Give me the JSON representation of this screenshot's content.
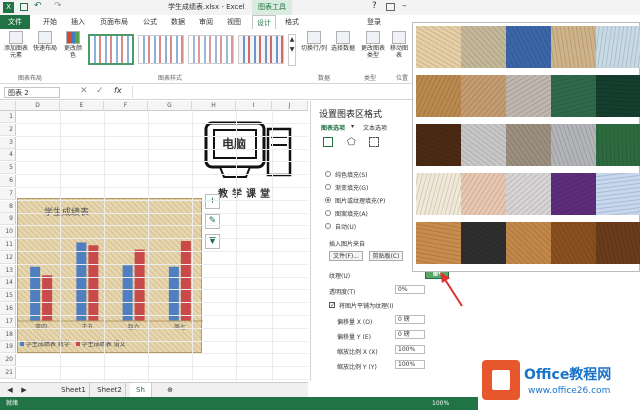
{
  "window": {
    "title": "学生成绩表.xlsx - Excel",
    "tool_context": "图表工具",
    "login": "登录"
  },
  "tabs": [
    "文件",
    "开始",
    "插入",
    "页面布局",
    "公式",
    "数据",
    "审阅",
    "视图",
    "设计",
    "格式"
  ],
  "ribbon": {
    "buttons": {
      "add_element": "添加图表元素",
      "quick_layout": "快速布局",
      "change_color": "更改颜色",
      "switch_rowcol": "切换行/列",
      "select_data": "选择数据",
      "change_type": "更改图表类型",
      "move": "移动图表"
    },
    "groups": {
      "layout": "图表布局",
      "styles": "图表样式",
      "data": "数据",
      "type": "类型",
      "position": "位置"
    }
  },
  "formula_bar": {
    "name_box": "图表 2",
    "fx": "fx"
  },
  "sheet": {
    "columns": [
      "D",
      "E",
      "F",
      "G",
      "H",
      "I",
      "J"
    ],
    "rows": [
      "1",
      "2",
      "3",
      "4",
      "5",
      "6",
      "7",
      "8",
      "9",
      "10",
      "11",
      "12",
      "13",
      "14",
      "15",
      "16",
      "17",
      "18",
      "19",
      "20",
      "21"
    ],
    "tabs": [
      "Sheet1",
      "Sheet2",
      "Sh"
    ]
  },
  "logo": {
    "line1": "电脑",
    "line2": "教学课堂"
  },
  "chart_data": {
    "type": "bar",
    "title": "学生成绩表",
    "categories": [
      "李四",
      "王五",
      "赵六",
      "周七"
    ],
    "series": [
      {
        "name": "学生成绩表 数学",
        "values": [
          78,
          95,
          79,
          78
        ]
      },
      {
        "name": "学生成绩表 语文",
        "values": [
          72,
          93,
          90,
          96
        ]
      }
    ],
    "ylim": [
      40,
      110
    ],
    "legend": "bottom",
    "colors": [
      "#4f7fc0",
      "#c94a4a"
    ]
  },
  "pane": {
    "title": "设置图表区格式",
    "tab_chart": "图表选项",
    "tab_text": "文本选项",
    "fill_options": [
      "纯色填充(S)",
      "渐变填充(G)",
      "图片或纹理填充(P)",
      "图案填充(A)",
      "自动(U)"
    ],
    "insert_from": "插入图片来自",
    "file_btn": "文件(F)...",
    "clipboard_btn": "剪贴板(C)",
    "texture_label": "纹理(U)",
    "transparency_label": "透明度(T)",
    "transparency_value": "0%",
    "tile_checkbox": "将图片平铺为纹理(I)",
    "offset_x_label": "偏移量 X (O)",
    "offset_x_value": "0 磅",
    "offset_y_label": "偏移量 Y (E)",
    "offset_y_value": "0 磅",
    "scale_x_label": "缩放比例 X (X)",
    "scale_x_value": "100%",
    "scale_y_label": "缩放比例 Y (Y)",
    "scale_y_value": "100%"
  },
  "status": {
    "ready": "就绪",
    "zoom": "100%"
  },
  "watermark": {
    "brand": "Office教程网",
    "url": "www.office26.com"
  },
  "textures": [
    "#e6cfa5",
    "#c4b899",
    "#3b66a8",
    "#cfb48a",
    "#c8d9e6",
    "#b9894f",
    "#c49c6f",
    "#bfb6ad",
    "#2e6a4a",
    "#153e2e",
    "#4a2a14",
    "#c7c7c7",
    "#9c8f7f",
    "#b2b4b8",
    "#2d6b3f",
    "#f1e9d8",
    "#e8c7b1",
    "#d7d4d6",
    "#5d2c7a",
    "#c6d6ee",
    "#c98c4d",
    "#2e2e2e",
    "#c4874a",
    "#8a4f1f",
    "#6b3c1b"
  ]
}
